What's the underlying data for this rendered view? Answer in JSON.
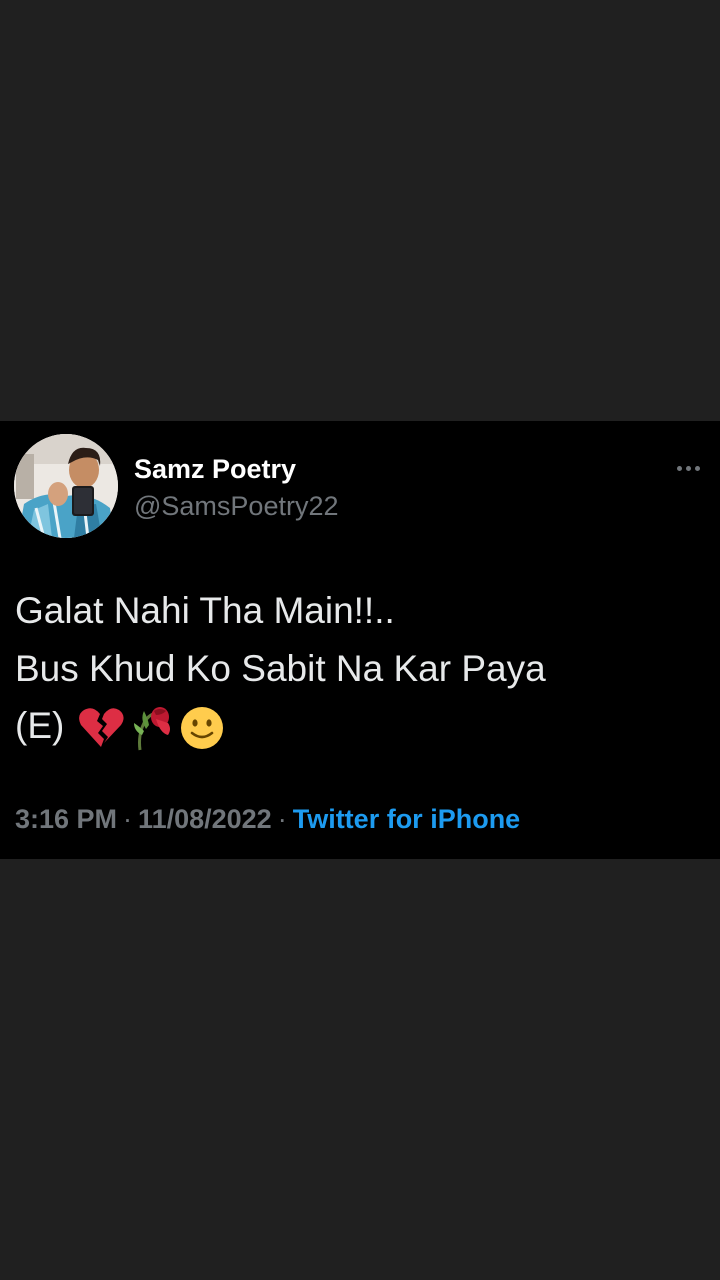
{
  "tweet": {
    "author": {
      "display_name": "Samz Poetry",
      "handle": "@SamsPoetry22"
    },
    "text_lines": [
      "Galat Nahi Tha Main!!..",
      "Bus Khud Ko Sabit Na Kar Paya",
      "(E)"
    ],
    "emojis": [
      "broken-heart-icon",
      "wilted-flower-icon",
      "slightly-smiling-face-icon"
    ],
    "time": "3:16 PM",
    "date": "11/08/2022",
    "separator": "·",
    "source": "Twitter for iPhone"
  },
  "colors": {
    "background": "#202020",
    "card": "#000000",
    "primary_text": "#e7e9ea",
    "secondary_text": "#71767b",
    "link": "#1d9bf0"
  }
}
